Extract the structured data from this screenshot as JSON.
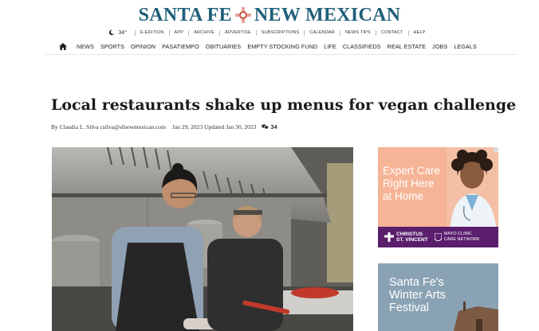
{
  "masthead": {
    "left": "SANTA FE",
    "right": "NEW MEXICAN"
  },
  "utility": {
    "temperature": "34°",
    "links": [
      "E-EDITION",
      "APP",
      "ARCHIVE",
      "ADVERTISE",
      "SUBSCRIPTIONS",
      "CALENDAR",
      "NEWS TIPS",
      "CONTACT",
      "HELP"
    ]
  },
  "nav": {
    "items": [
      "NEWS",
      "SPORTS",
      "OPINION",
      "PASATIEMPO",
      "OBITUARIES",
      "EMPTY STOCKING FUND",
      "LIFE",
      "CLASSIFIEDS",
      "REAL ESTATE",
      "JOBS",
      "LEGALS"
    ]
  },
  "article": {
    "headline": "Local restaurants shake up menus for vegan challenge",
    "byline": "By Claudia L. Silva csilva@sfnewmexican.com",
    "dates": "Jan 29, 2023 Updated Jan 30, 2023",
    "comment_count": "34"
  },
  "ads": {
    "ad1": {
      "line1": "Expert Care",
      "line2": "Right Here",
      "line3": "at Home",
      "sponsor1_line1": "CHRISTUS",
      "sponsor1_line2": "ST. VINCENT",
      "sponsor2_line1": "MAYO CLINIC",
      "sponsor2_line2": "CARE NETWORK",
      "adchoice": "i"
    },
    "ad2": {
      "line1": "Santa Fe's",
      "line2": "Winter Arts",
      "line3": "Festival"
    }
  },
  "colors": {
    "brand": "#1f5f7a",
    "ad_peach": "#f6b496",
    "ad_purple": "#5a1e6d",
    "ad_slate": "#8aa3b4"
  }
}
